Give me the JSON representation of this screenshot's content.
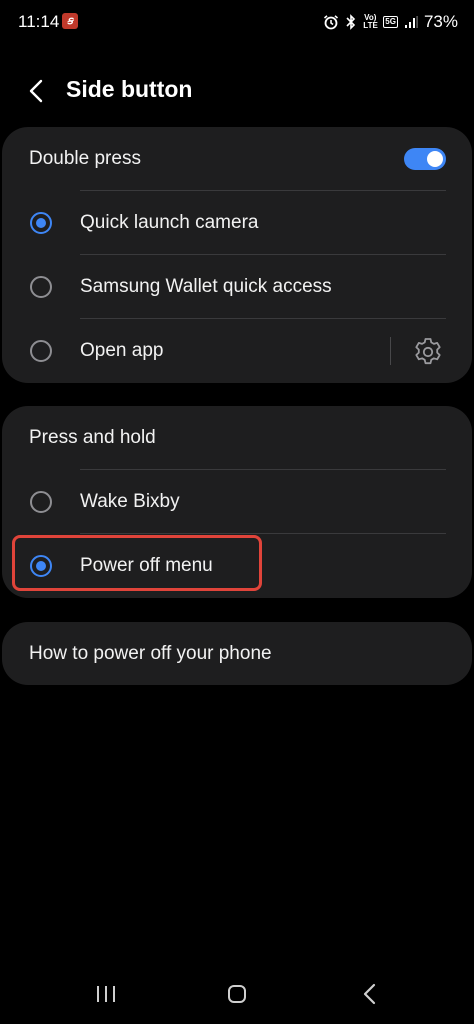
{
  "status_bar": {
    "time": "11:14",
    "app_icon_glyph": "ꞩ",
    "battery": "73%",
    "volte_label": "Vo)\nLTE",
    "net_label": "5G"
  },
  "header": {
    "title": "Side button"
  },
  "double_press": {
    "label": "Double press",
    "enabled": true,
    "options": [
      {
        "label": "Quick launch camera",
        "selected": true
      },
      {
        "label": "Samsung Wallet quick access",
        "selected": false
      },
      {
        "label": "Open app",
        "selected": false
      }
    ]
  },
  "press_and_hold": {
    "label": "Press and hold",
    "options": [
      {
        "label": "Wake Bixby",
        "selected": false
      },
      {
        "label": "Power off menu",
        "selected": true
      }
    ]
  },
  "help": {
    "label": "How to power off your phone"
  },
  "colors": {
    "accent": "#3e86f5",
    "card": "#1e1e1f",
    "highlight": "#e0443a"
  },
  "icons": [
    "back-icon",
    "gear-icon",
    "alarm-icon",
    "bluetooth-icon",
    "signal-icon",
    "nav-recents-icon",
    "nav-home-icon",
    "nav-back-icon"
  ]
}
